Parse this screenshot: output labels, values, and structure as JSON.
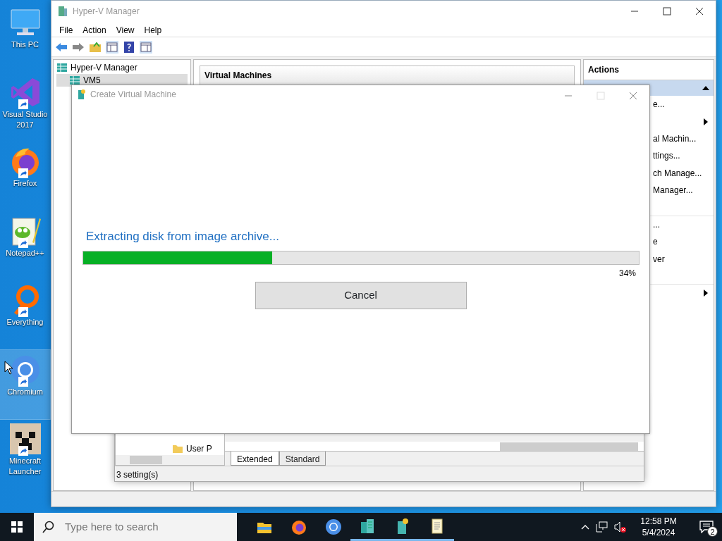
{
  "desktop_icons": [
    {
      "label": "This PC",
      "kind": "pc",
      "shortcut": false,
      "selected": false
    },
    {
      "label": "Visual Studio 2017",
      "kind": "vs",
      "shortcut": true,
      "selected": false
    },
    {
      "label": "Firefox",
      "kind": "firefox",
      "shortcut": true,
      "selected": false
    },
    {
      "label": "Notepad++",
      "kind": "notepad",
      "shortcut": true,
      "selected": false
    },
    {
      "label": "Everything",
      "kind": "everything",
      "shortcut": true,
      "selected": false
    },
    {
      "label": "Chromium",
      "kind": "chromium",
      "shortcut": true,
      "selected": true
    },
    {
      "label": "Minecraft Launcher",
      "kind": "minecraft",
      "shortcut": true,
      "selected": false
    }
  ],
  "hyperv": {
    "title": "Hyper-V Manager",
    "menu": [
      "File",
      "Action",
      "View",
      "Help"
    ],
    "tree": [
      {
        "label": "Hyper-V Manager",
        "selected": false,
        "children": [
          {
            "label": "VM5",
            "selected": true
          }
        ]
      }
    ],
    "center_header": "Virtual Machines",
    "actions": {
      "title": "Actions",
      "items": [
        {
          "kind": "text",
          "text": "e..."
        },
        {
          "kind": "submenu"
        },
        {
          "kind": "text",
          "text": "al Machin..."
        },
        {
          "kind": "text",
          "text": "ttings..."
        },
        {
          "kind": "text",
          "text": "ch Manage..."
        },
        {
          "kind": "text",
          "text": "Manager..."
        },
        {
          "kind": "gap"
        },
        {
          "kind": "text",
          "text": "..."
        },
        {
          "kind": "text",
          "text": "e"
        },
        {
          "kind": "text",
          "text": "ver"
        },
        {
          "kind": "gap"
        },
        {
          "kind": "submenu"
        }
      ]
    }
  },
  "settings_window": {
    "tree_item": "User P",
    "tabs": [
      {
        "label": "Extended",
        "selected": true
      },
      {
        "label": "Standard",
        "selected": false
      }
    ],
    "status": "3 setting(s)"
  },
  "dialog": {
    "title": "Create Virtual Machine",
    "message": "Extracting disk from image archive...",
    "level": 0.34,
    "percent": "34%",
    "button": "Cancel"
  },
  "taskbar": {
    "search_placeholder": "Type here to search",
    "apps": [
      {
        "kind": "folder",
        "running": false
      },
      {
        "kind": "firefox",
        "running": false
      },
      {
        "kind": "chromium",
        "running": false
      },
      {
        "kind": "server",
        "running": true
      },
      {
        "kind": "server-new",
        "running": true
      },
      {
        "kind": "scroll",
        "running": true
      }
    ],
    "time": "12:58 PM",
    "date": "5/4/2024",
    "notifications": "2"
  }
}
